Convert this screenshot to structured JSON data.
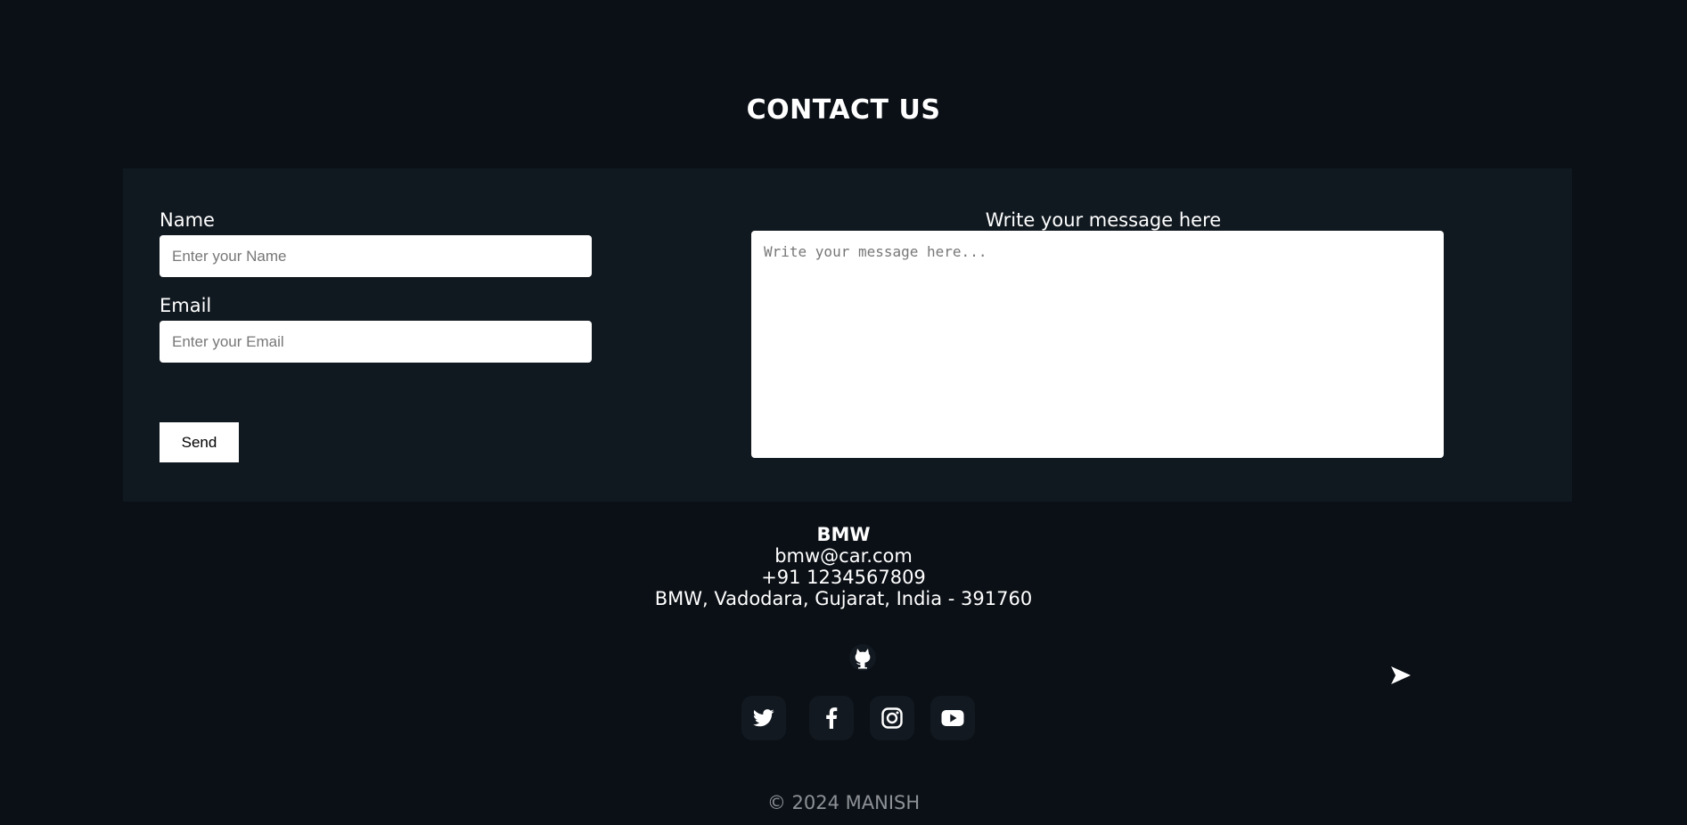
{
  "page_title": "CONTACT US",
  "form": {
    "name_label": "Name",
    "name_placeholder": "Enter your Name",
    "email_label": "Email",
    "email_placeholder": "Enter your Email",
    "send_label": "Send",
    "message_label": "Write your message here",
    "message_placeholder": "Write your message here..."
  },
  "contact": {
    "brand": "BMW",
    "email": "bmw@car.com",
    "phone": "+91 1234567809",
    "address": "BMW, Vadodara, Gujarat, India - 391760"
  },
  "icons": {
    "github": "github-icon",
    "socials": [
      "twitter-icon",
      "facebook-icon",
      "instagram-icon",
      "youtube-icon"
    ],
    "send_arrow": "send-arrow-icon"
  },
  "footer": {
    "copyright": "© 2024 MANISH"
  },
  "colors": {
    "background": "#0b1016",
    "panel": "#111920",
    "social_bg": "#121920",
    "copyright": "#8d9196"
  }
}
